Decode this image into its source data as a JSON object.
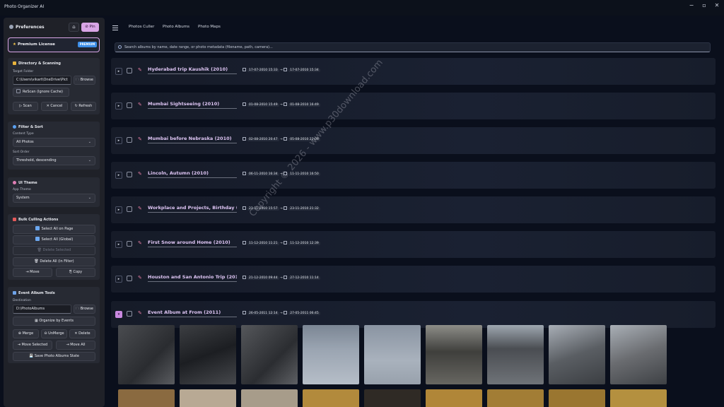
{
  "app": {
    "title": "Photo Organizer AI"
  },
  "window": {
    "minimize": "−",
    "maximize": "▫",
    "close": "✕"
  },
  "sidebar": {
    "preferences": "Preferences",
    "home_icon": "⌂",
    "pin_label": "⊘ Pin",
    "license": {
      "label": "Premium License",
      "badge": "PREMIUM"
    },
    "directory": {
      "title": "Directory & Scanning",
      "target_label": "Target Folder",
      "target_value": "C:\\Users\\vikart\\OneDrive\\Pict",
      "browse": "Browse",
      "rescan": "ReScan (Ignore Cache)",
      "scan": "▷ Scan",
      "cancel": "✕ Cancel",
      "refresh": "↻ Refresh"
    },
    "filter": {
      "title": "Filter & Sort",
      "content_label": "Content Type",
      "content_value": "All Photos",
      "sort_label": "Sort Order",
      "sort_value": "Threshold, descending"
    },
    "theme": {
      "title": "UI Theme",
      "label": "App Theme",
      "value": "System"
    },
    "bulk": {
      "title": "Bulk Culling Actions",
      "select_page": "Select All on Page",
      "select_global": "Select All (Global)",
      "delete_selected": "Delete Selected",
      "delete_all": "Delete All (in Filter)",
      "move": "Move",
      "copy": "Copy"
    },
    "event": {
      "title": "Event Album Tools",
      "dest_label": "Destination",
      "dest_value": "D:\\PhotoAlbums",
      "browse": "Browse",
      "organize": "Organize by Events",
      "merge": "Merge",
      "unmerge": "UnMerge",
      "delete": "Delete",
      "move_selected": "Move Selected",
      "move_all": "Move All",
      "save_state": "Save Photo Albums State"
    }
  },
  "nav": {
    "tabs": [
      "Photos Culler",
      "Photo Albums",
      "Photo Maps"
    ]
  },
  "search": {
    "placeholder": "Search albums by name, date range, or photo metadata (filename, path, camera)..."
  },
  "albums": [
    {
      "name": "Hyderabad trip Kaushik (2010)",
      "start": "17-07-2010 15:33",
      "end": "17-07-2010 15:34"
    },
    {
      "name": "Mumbai Sightseeing (2010)",
      "start": "01-08-2010 15:49",
      "end": "01-08-2010 16:49"
    },
    {
      "name": "Mumbai before Nebraska (2010)",
      "start": "02-08-2010 20:47",
      "end": "05-08-2010 22:06"
    },
    {
      "name": "Lincoln, Autumn (2010)",
      "start": "06-11-2010 16:34",
      "end": "11-11-2010 16:50"
    },
    {
      "name": "Workplace and Projects, Birthday (2",
      "start": "23-11-2010 15:57",
      "end": "23-11-2010 21:32"
    },
    {
      "name": "First Snow around Home (2010)",
      "start": "11-12-2010 11:21",
      "end": "11-12-2010 12:39"
    },
    {
      "name": "Houston and San Antonio Trip (201",
      "start": "21-12-2010 09:44",
      "end": "27-12-2010 11:14"
    },
    {
      "name": "Event Album at From (2011)",
      "start": "26-05-2011 12:14",
      "end": "27-05-2011 06:45"
    }
  ],
  "watermark": "Copyright © 2026 - www.p30download.com"
}
